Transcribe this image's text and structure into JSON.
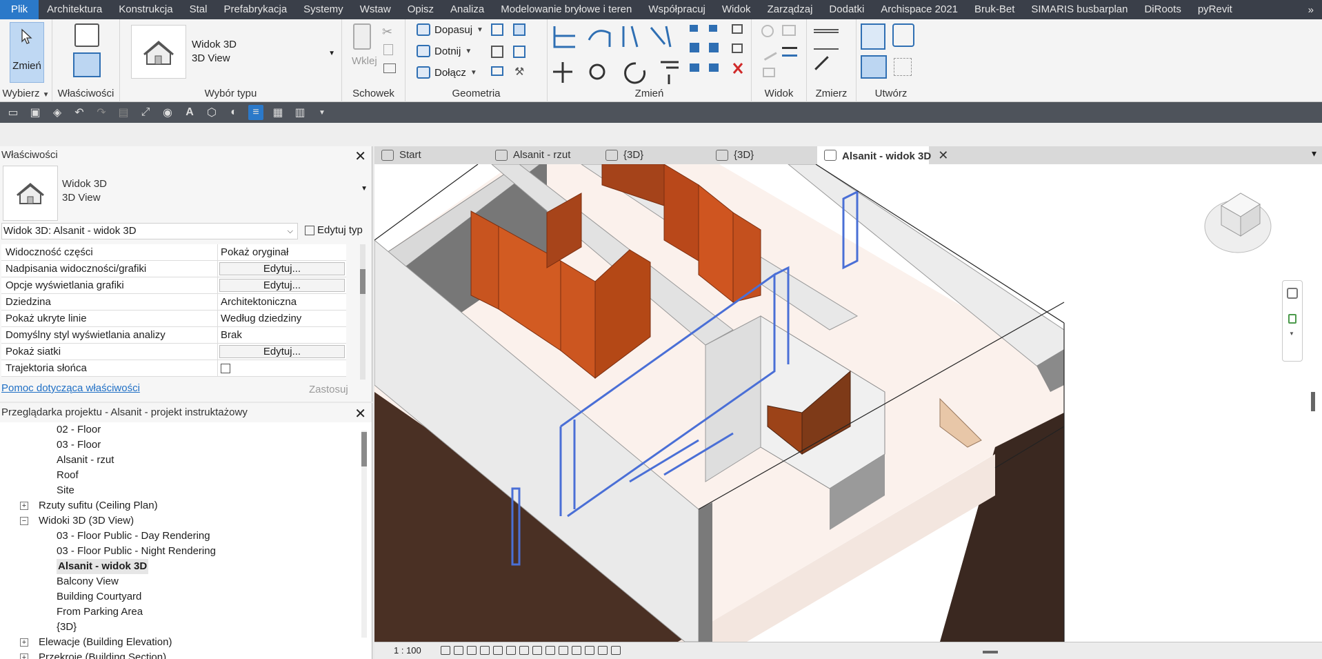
{
  "menu": {
    "items": [
      "Plik",
      "Architektura",
      "Konstrukcja",
      "Stal",
      "Prefabrykacja",
      "Systemy",
      "Wstaw",
      "Opisz",
      "Analiza",
      "Modelowanie bryłowe i teren",
      "Współpracuj",
      "Widok",
      "Zarządzaj",
      "Dodatki",
      "Archispace 2021",
      "Bruk-Bet",
      "SIMARIS busbarplan",
      "DiRoots",
      "pyRevit"
    ],
    "active_index": 0,
    "overflow": "»"
  },
  "ribbon": {
    "modify_label": "Zmień",
    "type_selector": {
      "line1": "Widok 3D",
      "line2": "3D View"
    },
    "geometry": {
      "cope": "Dopasuj",
      "cut": "Dotnij",
      "join": "Dołącz"
    },
    "paste_label": "Wklej",
    "panels": [
      "Wybierz",
      "Właściwości",
      "Wybór typu",
      "Schowek",
      "Geometria",
      "Zmień",
      "Widok",
      "Zmierz",
      "Utwórz"
    ]
  },
  "properties": {
    "title": "Właściwości",
    "type_line1": "Widok 3D",
    "type_line2": "3D View",
    "instance": "Widok 3D: Alsanit - widok 3D",
    "edit_type": "Edytuj typ",
    "rows": [
      {
        "k": "Widoczność części",
        "v": "Pokaż oryginał",
        "btn": false
      },
      {
        "k": "Nadpisania widoczności/grafiki",
        "v": "Edytuj...",
        "btn": true
      },
      {
        "k": "Opcje wyświetlania grafiki",
        "v": "Edytuj...",
        "btn": true
      },
      {
        "k": "Dziedzina",
        "v": "Architektoniczna",
        "btn": false
      },
      {
        "k": "Pokaż ukryte linie",
        "v": "Według dziedziny",
        "btn": false
      },
      {
        "k": "Domyślny styl wyświetlania analizy",
        "v": "Brak",
        "btn": false
      },
      {
        "k": "Pokaż siatki",
        "v": "Edytuj...",
        "btn": true
      },
      {
        "k": "Trajektoria słońca",
        "v": "",
        "checkbox": true,
        "checked": false
      }
    ],
    "help_link": "Pomoc dotycząca właściwości",
    "apply": "Zastosuj"
  },
  "browser": {
    "title": "Przeglądarka projektu - Alsanit - projekt instruktażowy",
    "nodes": [
      {
        "label": "02 - Floor",
        "level": 3
      },
      {
        "label": "03 - Floor",
        "level": 3
      },
      {
        "label": "Alsanit - rzut",
        "level": 3
      },
      {
        "label": "Roof",
        "level": 3
      },
      {
        "label": "Site",
        "level": 3
      },
      {
        "label": "Rzuty sufitu (Ceiling Plan)",
        "level": 2,
        "toggle": "+"
      },
      {
        "label": "Widoki 3D (3D View)",
        "level": 2,
        "toggle": "−"
      },
      {
        "label": "03 - Floor Public - Day Rendering",
        "level": 3
      },
      {
        "label": "03 - Floor Public - Night Rendering",
        "level": 3
      },
      {
        "label": "Alsanit - widok 3D",
        "level": 3,
        "selected": true
      },
      {
        "label": "Balcony View",
        "level": 3
      },
      {
        "label": "Building Courtyard",
        "level": 3
      },
      {
        "label": "From Parking Area",
        "level": 3
      },
      {
        "label": "{3D}",
        "level": 3
      },
      {
        "label": "Elewacje (Building Elevation)",
        "level": 2,
        "toggle": "+"
      },
      {
        "label": "Przekroje (Building Section)",
        "level": 2,
        "toggle": "+"
      }
    ]
  },
  "tabs": [
    {
      "label": "Start",
      "icon": "start-page-icon"
    },
    {
      "label": "Alsanit - rzut",
      "icon": "floor-plan-icon"
    },
    {
      "label": "{3D}",
      "icon": "3d-view-icon"
    },
    {
      "label": "{3D}",
      "icon": "3d-view-icon"
    },
    {
      "label": "Alsanit - widok 3D",
      "icon": "3d-view-icon",
      "active": true,
      "close": "✕"
    }
  ],
  "status": {
    "scale": "1 : 100"
  },
  "colors": {
    "menubar": "#3a3f49",
    "menu_active": "#2b79c9",
    "partition": "#c8541f",
    "selection": "#4a6fd6",
    "link": "#1f6fc5"
  }
}
